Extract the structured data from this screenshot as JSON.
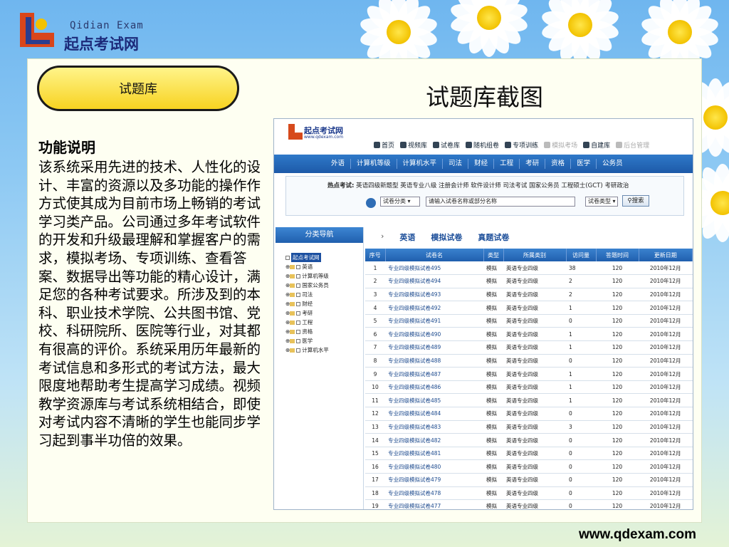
{
  "brand": {
    "en": "Qidian Exam",
    "cn": "起点考试网"
  },
  "slide": {
    "pill_label": "试题库",
    "title": "试题库截图",
    "func_title": "功能说明",
    "func_text": "该系统采用先进的技术、人性化的设计、丰富的资源以及多功能的操作作方式使其成为目前市场上畅销的考试学习类产品。公司通过多年考试软件的开发和升级最理解和掌握客户的需求，模拟考场、专项训练、查看答案、数据导出等功能的精心设计，满足您的各种考试要求。所涉及到的本科、职业技术学院、公共图书馆、党校、科研院所、医院等行业，对其都有很高的评价。系统采用历年最新的考试信息和多形式的考试方法，最大限度地帮助考生提高学习成绩。视频教学资源库与考试系统相结合，即使对考试内容不清晰的学生也能同步学习起到事半功倍的效果。",
    "footer_url": "www.qdexam.com"
  },
  "shot": {
    "logo_cn": "起点考试网",
    "logo_en": "www.qdexam.com",
    "nav": [
      "首页",
      "视频库",
      "试卷库",
      "随机组卷",
      "专项训练",
      "模拟考场",
      "自建库",
      "后台管理"
    ],
    "menu": [
      "外语",
      "计算机等级",
      "计算机水平",
      "司法",
      "财经",
      "工程",
      "考研",
      "资格",
      "医学",
      "公务员"
    ],
    "hot_label": "热点考试:",
    "hot_items": "英语四级新题型 英语专业八级 注册会计师 软件设计师 司法考试 国家公务员 工程硕士(GCT) 考研政治",
    "select_category": "试卷分类",
    "search_placeholder": "请输入试卷名称或部分名称",
    "select_type": "试卷类型",
    "search_button": "搜索",
    "sidebar_title": "分类导航",
    "tree_root": "起点考试网",
    "tree_items": [
      "英语",
      "计算机等级",
      "国家公务员",
      "司法",
      "财经",
      "考研",
      "工程",
      "资格",
      "医学",
      "计算机水平"
    ],
    "breadcrumb": [
      "英语",
      "模拟试卷",
      "真题试卷"
    ],
    "table_headers": [
      "序号",
      "试卷名",
      "类型",
      "所属类别",
      "访问量",
      "答题时间",
      "更新日期"
    ],
    "rows": [
      [
        "1",
        "专业四级模拟试卷495",
        "模拟",
        "英语专业四级",
        "38",
        "120",
        "2010年12月"
      ],
      [
        "2",
        "专业四级模拟试卷494",
        "模拟",
        "英语专业四级",
        "2",
        "120",
        "2010年12月"
      ],
      [
        "3",
        "专业四级模拟试卷493",
        "模拟",
        "英语专业四级",
        "2",
        "120",
        "2010年12月"
      ],
      [
        "4",
        "专业四级模拟试卷492",
        "模拟",
        "英语专业四级",
        "1",
        "120",
        "2010年12月"
      ],
      [
        "5",
        "专业四级模拟试卷491",
        "模拟",
        "英语专业四级",
        "0",
        "120",
        "2010年12月"
      ],
      [
        "6",
        "专业四级模拟试卷490",
        "模拟",
        "英语专业四级",
        "1",
        "120",
        "2010年12月"
      ],
      [
        "7",
        "专业四级模拟试卷489",
        "模拟",
        "英语专业四级",
        "1",
        "120",
        "2010年12月"
      ],
      [
        "8",
        "专业四级模拟试卷488",
        "模拟",
        "英语专业四级",
        "0",
        "120",
        "2010年12月"
      ],
      [
        "9",
        "专业四级模拟试卷487",
        "模拟",
        "英语专业四级",
        "1",
        "120",
        "2010年12月"
      ],
      [
        "10",
        "专业四级模拟试卷486",
        "模拟",
        "英语专业四级",
        "1",
        "120",
        "2010年12月"
      ],
      [
        "11",
        "专业四级模拟试卷485",
        "模拟",
        "英语专业四级",
        "1",
        "120",
        "2010年12月"
      ],
      [
        "12",
        "专业四级模拟试卷484",
        "模拟",
        "英语专业四级",
        "0",
        "120",
        "2010年12月"
      ],
      [
        "13",
        "专业四级模拟试卷483",
        "模拟",
        "英语专业四级",
        "3",
        "120",
        "2010年12月"
      ],
      [
        "14",
        "专业四级模拟试卷482",
        "模拟",
        "英语专业四级",
        "0",
        "120",
        "2010年12月"
      ],
      [
        "15",
        "专业四级模拟试卷481",
        "模拟",
        "英语专业四级",
        "0",
        "120",
        "2010年12月"
      ],
      [
        "16",
        "专业四级模拟试卷480",
        "模拟",
        "英语专业四级",
        "0",
        "120",
        "2010年12月"
      ],
      [
        "17",
        "专业四级模拟试卷479",
        "模拟",
        "英语专业四级",
        "0",
        "120",
        "2010年12月"
      ],
      [
        "18",
        "专业四级模拟试卷478",
        "模拟",
        "英语专业四级",
        "0",
        "120",
        "2010年12月"
      ],
      [
        "19",
        "专业四级模拟试卷477",
        "模拟",
        "英语专业四级",
        "0",
        "120",
        "2010年12月"
      ]
    ]
  }
}
